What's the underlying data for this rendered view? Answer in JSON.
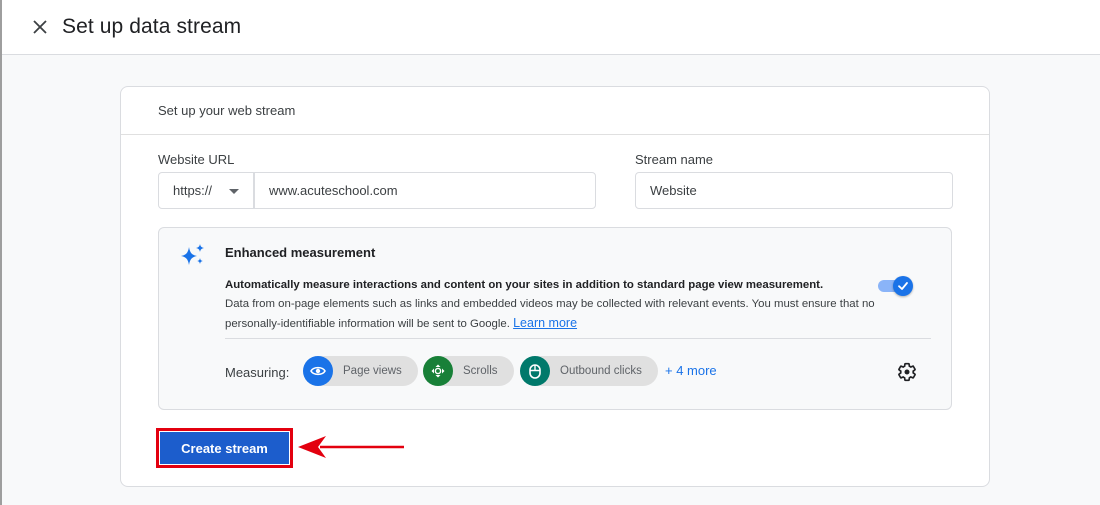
{
  "header": {
    "close_icon": "close-icon",
    "title": "Set up data stream"
  },
  "card": {
    "title": "Set up your web stream",
    "website_url": {
      "label": "Website URL",
      "protocol": "https://",
      "value": "www.acuteschool.com"
    },
    "stream_name": {
      "label": "Stream name",
      "value": "Website"
    },
    "enhanced_measurement": {
      "icon": "sparkle-icon",
      "title": "Enhanced measurement",
      "desc_bold": "Automatically measure interactions and content on your sites in addition to standard page view measurement.",
      "desc_text": "Data from on-page elements such as links and embedded videos may be collected with relevant events. You must ensure that no personally-identifiable information will be sent to Google.",
      "learn_more": "Learn more",
      "toggle_on": true,
      "measuring_label": "Measuring:",
      "chips": [
        {
          "label": "Page views",
          "icon": "eye-icon",
          "color": "#1a73e8"
        },
        {
          "label": "Scrolls",
          "icon": "scroll-icon",
          "color": "#188038"
        },
        {
          "label": "Outbound clicks",
          "icon": "mouse-icon",
          "color": "#00796b"
        }
      ],
      "more": "+ 4 more",
      "settings_icon": "gear-icon"
    },
    "create_button": "Create stream"
  },
  "colors": {
    "accent": "#1a73e8",
    "button": "#1c5dcc",
    "highlight": "#e3000f"
  }
}
